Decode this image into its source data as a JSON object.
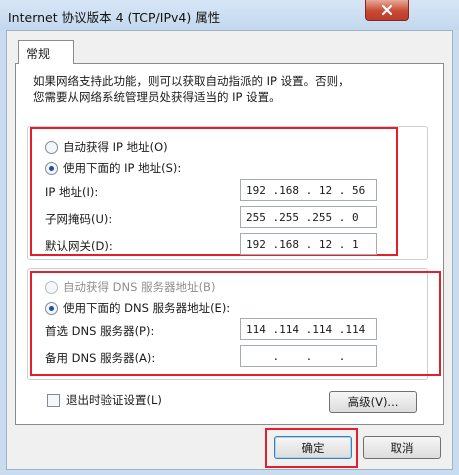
{
  "window": {
    "title": "Internet 协议版本 4 (TCP/IPv4) 属性",
    "close_glyph": "✕"
  },
  "tab": {
    "label": "常规"
  },
  "description": {
    "line1": "如果网络支持此功能，则可以获取自动指派的 IP 设置。否则，",
    "line2": "您需要从网络系统管理员处获得适当的 IP 设置。"
  },
  "ip_group": {
    "auto_label": "自动获得 IP 地址(O)",
    "manual_label": "使用下面的 IP 地址(S):",
    "selected": "manual",
    "fields": [
      {
        "label": "IP 地址(I):",
        "value": "192 .168 . 12 . 56"
      },
      {
        "label": "子网掩码(U):",
        "value": "255 .255 .255 . 0"
      },
      {
        "label": "默认网关(D):",
        "value": "192 .168 . 12 . 1"
      }
    ]
  },
  "dns_group": {
    "auto_label": "自动获得 DNS 服务器地址(B)",
    "manual_label": "使用下面的 DNS 服务器地址(E):",
    "selected": "manual",
    "fields": [
      {
        "label": "首选 DNS 服务器(P):",
        "value": "114 .114 .114 .114"
      },
      {
        "label": "备用 DNS 服务器(A):",
        "value": "    .    .    .   "
      }
    ]
  },
  "validate_checkbox": {
    "label": "退出时验证设置(L)",
    "checked": false
  },
  "buttons": {
    "advanced": "高级(V)...",
    "ok": "确定",
    "cancel": "取消"
  },
  "colors": {
    "highlight": "#e0202a",
    "selected_radio": "#1f4f9e"
  }
}
